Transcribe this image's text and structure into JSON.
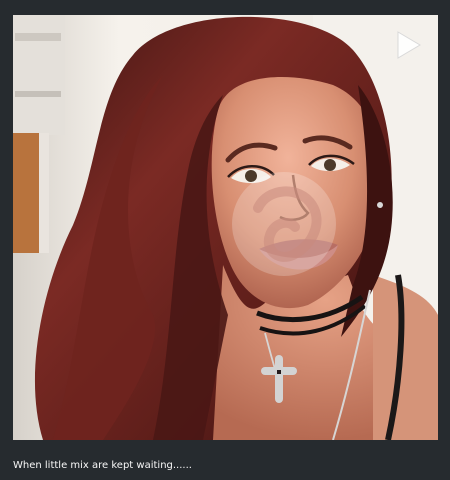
{
  "post": {
    "caption": "When little mix are kept waiting......"
  },
  "video": {
    "state": "paused",
    "play_icon": "play-icon",
    "watermark_icon": "loop-logo-icon"
  },
  "colors": {
    "page_background": "#262b2f",
    "caption_text": "#f7f7f7",
    "hair": "#5b1d19",
    "skin": "#d88f72"
  }
}
